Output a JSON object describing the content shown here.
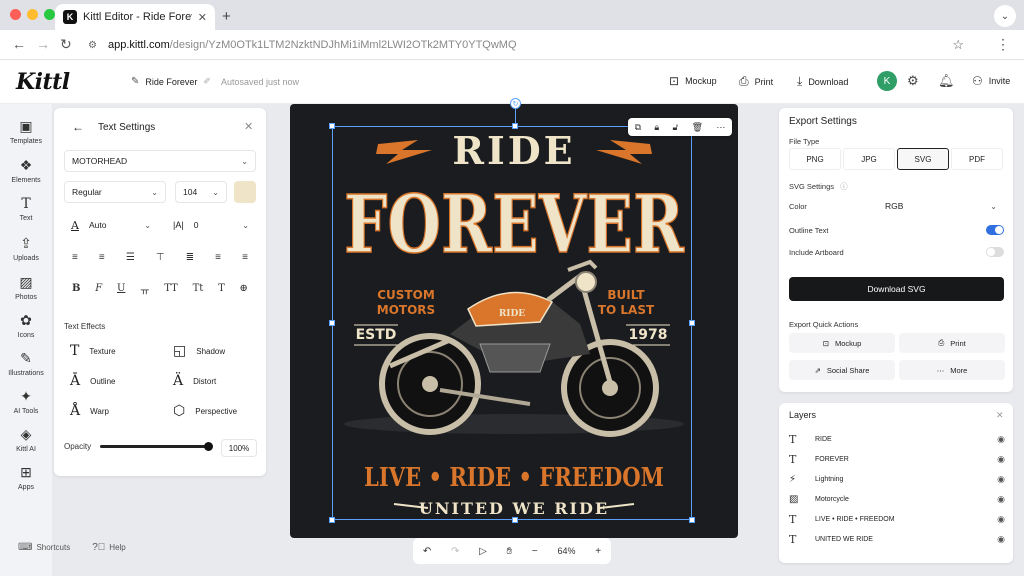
{
  "browser": {
    "tab_title": "Kittl Editor - Ride Forever",
    "tab_favicon": "K",
    "url_host": "app.kittl.com",
    "url_path": "/design/YzM0OTk1LTM2NzktNDJhMi1iMml2LWI2OTk2MTY0YTQwMQ",
    "traffic_colors": [
      "#ff5f57",
      "#febc2e",
      "#28c840"
    ]
  },
  "header": {
    "logo": "Kittl",
    "project_name": "Ride Forever",
    "autosave": "Autosaved just now",
    "mockup": "Mockup",
    "print": "Print",
    "download": "Download",
    "avatar_initial": "K",
    "invite": "Invite"
  },
  "rail": {
    "items": [
      {
        "label": "Templates",
        "icon": "templates-icon",
        "glyph": "▣"
      },
      {
        "label": "Elements",
        "icon": "elements-icon",
        "glyph": "❖"
      },
      {
        "label": "Text",
        "icon": "text-icon",
        "glyph": "T"
      },
      {
        "label": "Uploads",
        "icon": "upload-icon",
        "glyph": "⇪"
      },
      {
        "label": "Photos",
        "icon": "photos-icon",
        "glyph": "▨"
      },
      {
        "label": "Icons",
        "icon": "icons-icon",
        "glyph": "✿"
      },
      {
        "label": "Illustrations",
        "icon": "illustrations-icon",
        "glyph": "✎"
      },
      {
        "label": "AI Tools",
        "icon": "ai-tools-icon",
        "glyph": "✦"
      },
      {
        "label": "Kittl AI",
        "icon": "kittl-ai-icon",
        "glyph": "◈"
      },
      {
        "label": "Apps",
        "icon": "apps-icon",
        "glyph": "⊞"
      }
    ],
    "shortcuts": "Shortcuts",
    "help": "Help"
  },
  "text_settings": {
    "title": "Text Settings",
    "font": "MOTORHEAD",
    "weight": "Regular",
    "size": "104",
    "color": "#efe3c8",
    "line_height": "Auto",
    "letter_spacing": "0",
    "effects_label": "Text Effects",
    "effects": {
      "texture": "Texture",
      "shadow": "Shadow",
      "outline": "Outline",
      "distort": "Distort",
      "warp": "Warp",
      "perspective": "Perspective"
    },
    "opacity_label": "Opacity",
    "opacity_value": "100%",
    "opacity_fraction": 1.0
  },
  "artwork": {
    "title_top": "RIDE",
    "title_main": "FOREVER",
    "left_1": "CUSTOM",
    "left_2": "MOTORS",
    "right_1": "BUILT",
    "right_2": "TO LAST",
    "estd": "ESTD",
    "year": "1978",
    "tank": "RIDE",
    "slogan": "LIVE • RIDE • FREEDOM",
    "bottom": "UNITED WE RIDE",
    "cream": "#efe3c8",
    "orange": "#d9762b"
  },
  "canvas": {
    "zoom": "64%"
  },
  "export": {
    "title": "Export Settings",
    "file_type_label": "File Type",
    "types": [
      "PNG",
      "JPG",
      "SVG",
      "PDF"
    ],
    "svg_settings": "SVG Settings",
    "color_label": "Color",
    "color_value": "RGB",
    "outline_text": "Outline Text",
    "outline_on": true,
    "include_artboard": "Include Artboard",
    "artboard_on": false,
    "download_btn": "Download SVG",
    "quick_actions": "Export Quick Actions",
    "qa_mockup": "Mockup",
    "qa_print": "Print",
    "qa_social": "Social Share",
    "qa_more": "More"
  },
  "layers": {
    "title": "Layers",
    "items": [
      {
        "name": "RIDE",
        "glyph": "T"
      },
      {
        "name": "FOREVER",
        "glyph": "T"
      },
      {
        "name": "Lightning",
        "glyph": "⚡"
      },
      {
        "name": "Motorcycle",
        "glyph": "▨"
      },
      {
        "name": "LIVE • RIDE • FREEDOM",
        "glyph": "T"
      },
      {
        "name": "UNITED WE RIDE",
        "glyph": "T"
      }
    ]
  }
}
